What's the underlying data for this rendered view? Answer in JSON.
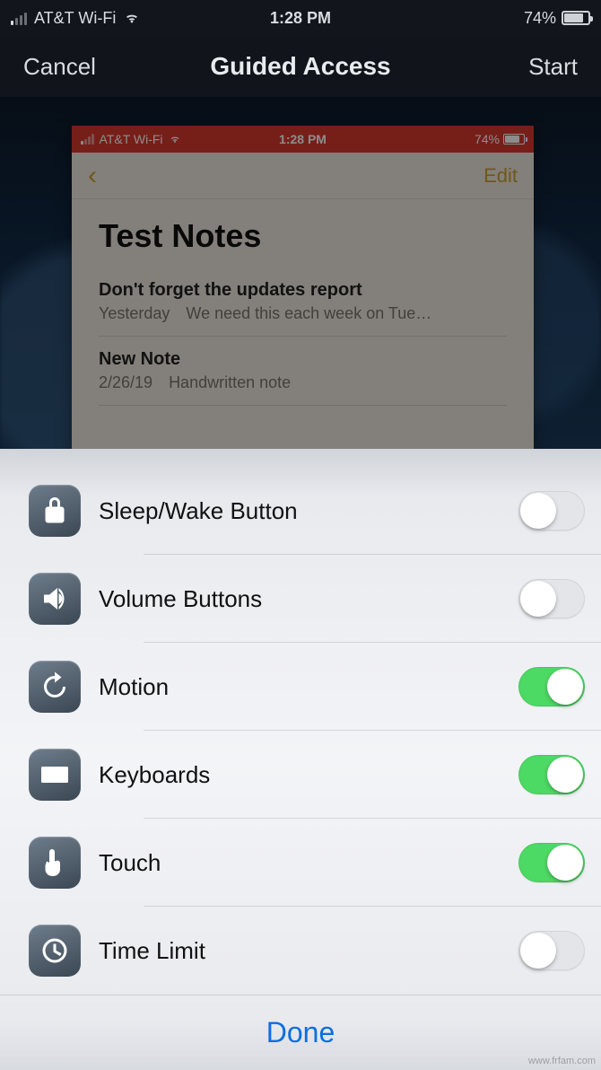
{
  "host_status": {
    "carrier": "AT&T Wi-Fi",
    "time": "1:28 PM",
    "battery_pct": "74%"
  },
  "host_nav": {
    "cancel": "Cancel",
    "title": "Guided Access",
    "start": "Start"
  },
  "preview": {
    "status": {
      "carrier": "AT&T Wi-Fi",
      "time": "1:28 PM",
      "battery_pct": "74%"
    },
    "edit": "Edit",
    "folder_title": "Test Notes",
    "notes": [
      {
        "title": "Don't forget the updates report",
        "date": "Yesterday",
        "snippet": "We need this each week on Tue…"
      },
      {
        "title": "New Note",
        "date": "2/26/19",
        "snippet": "Handwritten note"
      }
    ]
  },
  "options": [
    {
      "icon": "lock",
      "label": "Sleep/Wake Button",
      "on": false
    },
    {
      "icon": "volume",
      "label": "Volume Buttons",
      "on": false
    },
    {
      "icon": "motion",
      "label": "Motion",
      "on": true
    },
    {
      "icon": "keyboard",
      "label": "Keyboards",
      "on": true
    },
    {
      "icon": "touch",
      "label": "Touch",
      "on": true
    },
    {
      "icon": "timer",
      "label": "Time Limit",
      "on": false
    }
  ],
  "done": "Done",
  "watermark": "www.frfam.com"
}
